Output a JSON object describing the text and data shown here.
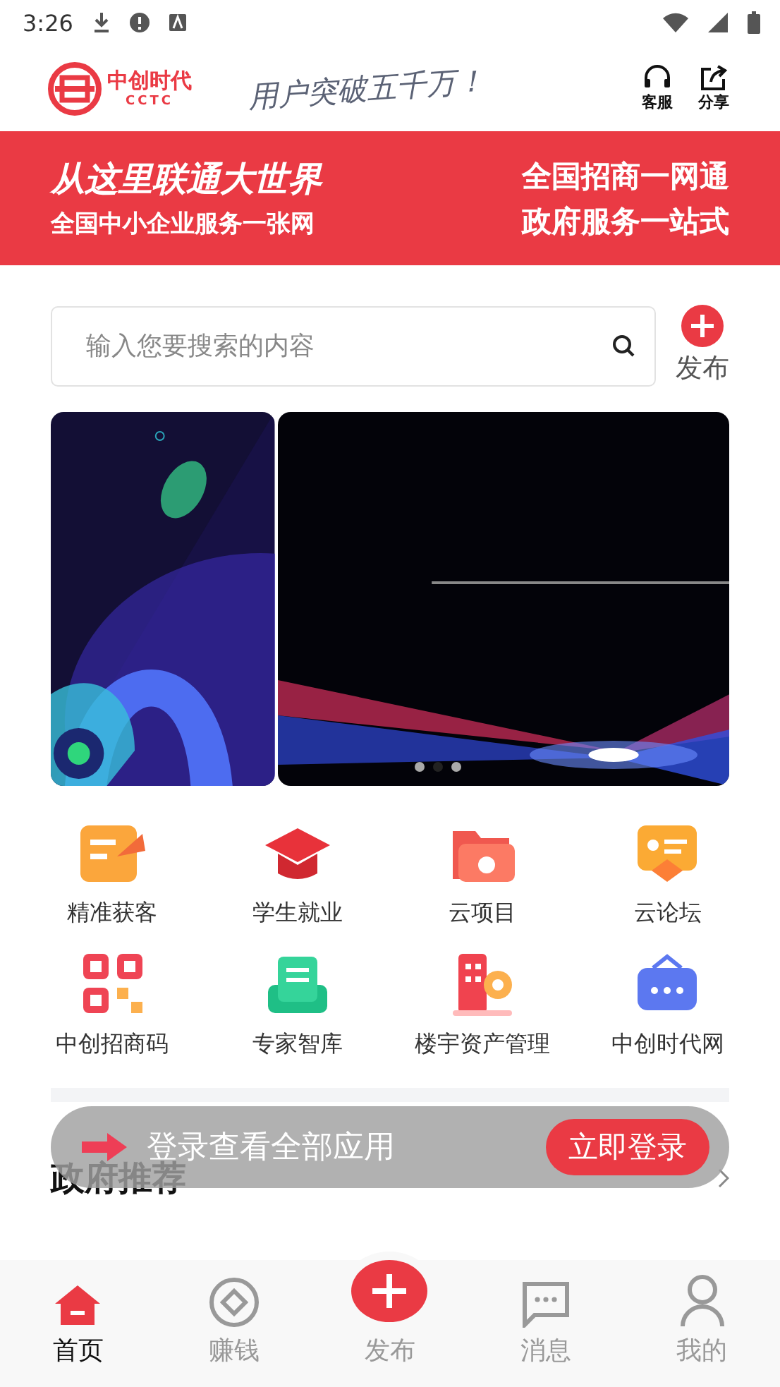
{
  "status_bar": {
    "time": "3:26"
  },
  "header": {
    "logo_text": "中创时代",
    "logo_sub": "CCTC",
    "slogan": "用户突破五千万！",
    "actions": [
      {
        "label": "客服"
      },
      {
        "label": "分享"
      }
    ]
  },
  "hero": {
    "left_title": "从这里联通大世界",
    "left_sub": "全国中小企业服务一张网",
    "right_lines": [
      "全国招商一网通",
      "政府服务一站式"
    ]
  },
  "search": {
    "placeholder": "输入您要搜索的内容"
  },
  "publish": {
    "label": "发布"
  },
  "carousel": {
    "dots": [
      {
        "selected": false
      },
      {
        "selected": true
      },
      {
        "selected": false
      }
    ]
  },
  "apps": [
    {
      "label": "精准获客"
    },
    {
      "label": "学生就业"
    },
    {
      "label": "云项目"
    },
    {
      "label": "云论坛"
    },
    {
      "label": "中创招商码"
    },
    {
      "label": "专家智库"
    },
    {
      "label": "楼宇资产管理"
    },
    {
      "label": "中创时代网"
    }
  ],
  "section": {
    "title": "政府推荐"
  },
  "login_toast": {
    "text": "登录查看全部应用",
    "button": "立即登录"
  },
  "tab_bar": [
    {
      "label": "首页",
      "kind": "tab",
      "selected": true
    },
    {
      "label": "赚钱",
      "kind": "tab",
      "selected": false
    },
    {
      "label": "发布",
      "kind": "publish",
      "selected": false
    },
    {
      "label": "消息",
      "kind": "tab",
      "selected": false
    },
    {
      "label": "我的",
      "kind": "tab",
      "selected": false
    }
  ]
}
